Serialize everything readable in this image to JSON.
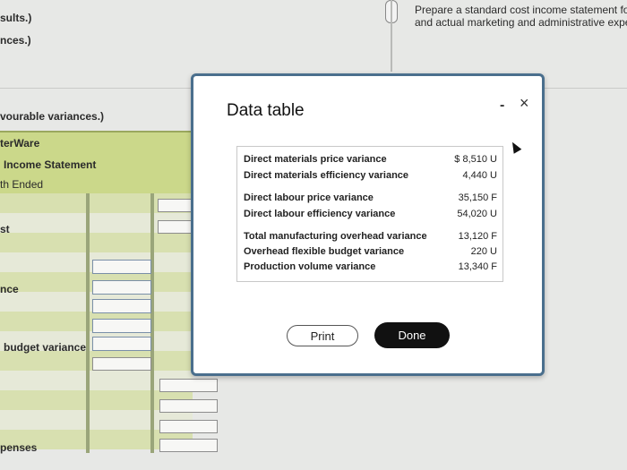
{
  "worksheet": {
    "label_1": "sults.)",
    "label_2": "nces.)",
    "label_3": "vourable variances.)",
    "company": "terWare",
    "statement": "Income Statement",
    "period": "th Ended",
    "row_st": "st",
    "row_nce": "nce",
    "row_budget_variance": "budget variance",
    "row_penses": "penses",
    "instruction_line1": "Prepare a standard cost income statement for E",
    "instruction_line2": "and actual marketing and administrative expense"
  },
  "dialog": {
    "title": "Data table",
    "groups": [
      {
        "rows": [
          {
            "label": "Direct materials price variance",
            "value": "$ 8,510 U"
          },
          {
            "label": "Direct materials efficiency variance",
            "value": "4,440 U"
          }
        ]
      },
      {
        "rows": [
          {
            "label": "Direct labour price variance",
            "value": "35,150 F"
          },
          {
            "label": "Direct labour efficiency variance",
            "value": "54,020 U"
          }
        ]
      },
      {
        "rows": [
          {
            "label": "Total manufacturing overhead variance",
            "value": "13,120 F"
          },
          {
            "label": "Overhead flexible budget variance",
            "value": "220 U"
          },
          {
            "label": "Production volume variance",
            "value": "13,340 F"
          }
        ]
      }
    ],
    "print_label": "Print",
    "done_label": "Done",
    "minimize_symbol": "-",
    "close_symbol": "×"
  }
}
